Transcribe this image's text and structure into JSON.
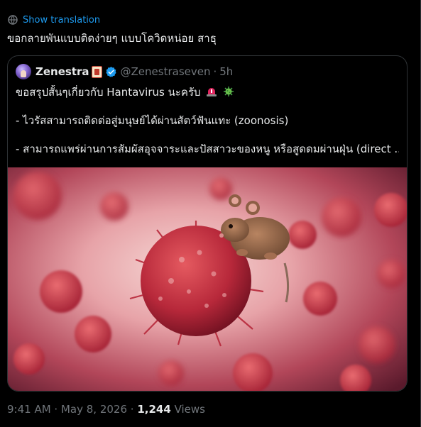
{
  "post": {
    "translate_label": "Show translation",
    "text": "ขอกลายพันแบบติดง่ายๆ แบบโควิดหน่อย สาธุ"
  },
  "quote": {
    "display_name": "Zenestra",
    "handle": "@Zenestraseven",
    "separator": "·",
    "time_ago": "5h",
    "line1": "ขอสรุปสั้นๆเกี่ยวกับ Hantavirus นะครับ",
    "line2": "- ไวรัสสามารถติดต่อสู่มนุษย์ได้ผ่านสัตว์ฟันแทะ (zoonosis)",
    "line3": "- สามารถแพร่ผ่านการสัมผัสอุจจาระและปัสสาวะของหนู หรือสูดดมผ่านฝุ่น (direct ..."
  },
  "meta": {
    "timestamp": "9:41 AM · May 8, 2026",
    "separator": "·",
    "views_count": "1,244",
    "views_label": "Views"
  },
  "colors": {
    "background": "#000000",
    "text_primary": "#e7e9ea",
    "text_secondary": "#71767b",
    "accent": "#1d9bf0",
    "border": "#2f3336"
  },
  "icons": [
    "globe-icon",
    "verified-icon",
    "siren-icon",
    "microbe-icon"
  ]
}
